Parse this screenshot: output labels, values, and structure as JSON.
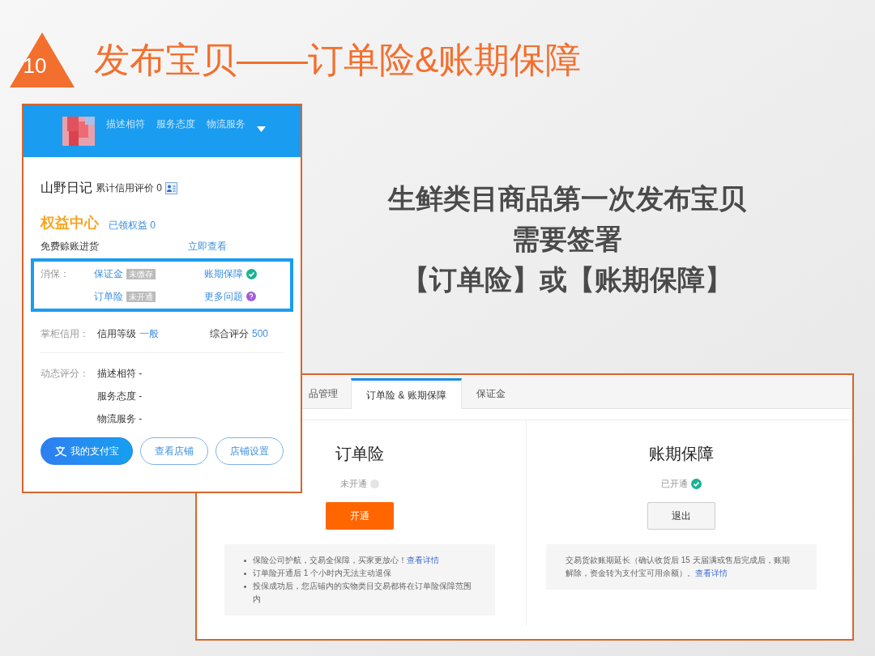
{
  "slide_title": {
    "number": "10",
    "text": "发布宝贝——订单险&账期保障"
  },
  "headline": [
    "生鲜类目商品第一次发布宝贝",
    "需要签署",
    "【订单险】或【账期保障】"
  ],
  "shop_card": {
    "header_labels": [
      "描述相符",
      "服务态度",
      "物流服务"
    ],
    "name": "山野日记",
    "credit_text": "累计信用评价 0",
    "benefits": {
      "title": "权益中心",
      "link": "已领权益 0",
      "row_text": "免费赊账进货",
      "row_link": "立即查看"
    },
    "protection": {
      "label": "消保：",
      "items": [
        {
          "name": "保证金",
          "kind": "badge",
          "badge": "未缴存"
        },
        {
          "name": "账期保障",
          "kind": "check"
        },
        {
          "name": "订单险",
          "kind": "badge",
          "badge": "未开通"
        },
        {
          "name": "更多问题",
          "kind": "question"
        }
      ]
    },
    "credit": {
      "label": "掌柜信用：",
      "level_label": "信用等级",
      "level_value": "一般",
      "score_label": "综合评分",
      "score_value": "500"
    },
    "ratings": {
      "label": "动态评分：",
      "items": [
        "描述相符 -",
        "服务态度 -",
        "物流服务 -"
      ]
    },
    "buttons": [
      {
        "label": "我的支付宝",
        "kind": "primary"
      },
      {
        "label": "查看店铺",
        "kind": "outline"
      },
      {
        "label": "店铺设置",
        "kind": "outline"
      }
    ]
  },
  "insurance_panel": {
    "tabs": [
      {
        "label": "品管理",
        "selected": false
      },
      {
        "label": "订单险 & 账期保障",
        "selected": true
      },
      {
        "label": "保证金",
        "selected": false
      }
    ],
    "columns": [
      {
        "title": "订单险",
        "status": "未开通",
        "active": false,
        "button": "开通",
        "notes": [
          {
            "text": "保险公司护航，交易全保障，买家更放心！",
            "link": "查看详情",
            "bulleted": true
          },
          {
            "text": "订单险开通后 1 个小时内无法主动退保",
            "bulleted": true
          },
          {
            "text": "投保成功后，您店铺内的实物类目交易都将在订单险保障范围内",
            "bulleted": true
          }
        ]
      },
      {
        "title": "账期保障",
        "status": "已开通",
        "active": true,
        "button": "退出",
        "notes": [
          {
            "text": "交易货款账期延长（确认收货后 15 天届满或售后完成后，账期解除，资金转为支付宝可用余额）。",
            "link": "查看详情",
            "bulleted": false
          }
        ]
      }
    ]
  }
}
